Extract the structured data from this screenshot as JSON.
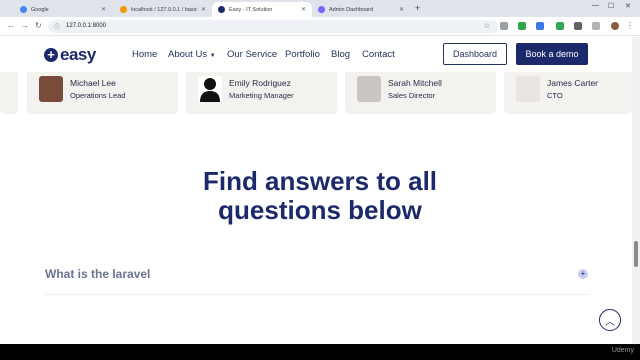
{
  "browser": {
    "tabs": [
      {
        "title": "Google",
        "color": "#4285f4"
      },
      {
        "title": "localhost / 127.0.0.1 / basic / st...",
        "color": "#f29900"
      },
      {
        "title": "Easy - IT Solution",
        "color": "#1c2a6b"
      },
      {
        "title": "Admin Dashboard",
        "color": "#7b61ff"
      }
    ],
    "new_tab": "+",
    "url": "127.0.0.1:8000"
  },
  "site": {
    "logo_text": "easy",
    "nav": [
      "Home",
      "About Us",
      "Our Service",
      "Portfolio",
      "Blog",
      "Contact"
    ],
    "dashboard_button": "Dashboard",
    "demo_button": "Book a demo"
  },
  "team": [
    {
      "name": "Michael Lee",
      "role": "Operations Lead"
    },
    {
      "name": "Emily Rodriguez",
      "role": "Marketing Manager"
    },
    {
      "name": "Sarah Mitchell",
      "role": "Sales Director"
    },
    {
      "name": "James Carter",
      "role": "CTO"
    }
  ],
  "faq": {
    "title_line1": "Find answers to all",
    "title_line2": "questions below",
    "question": "What is the laravel",
    "toggle": "+"
  },
  "watermark": "Udemy",
  "colors": {
    "brand": "#1c2a6b",
    "card_bg": "#f4f2ef"
  }
}
